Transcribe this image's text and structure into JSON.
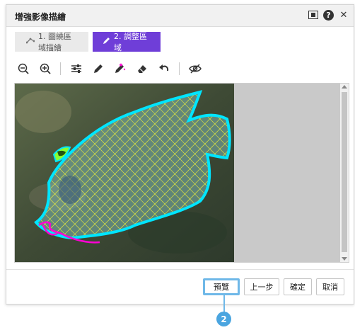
{
  "dialog": {
    "title": "增強影像描繪",
    "steps": [
      {
        "label": "1. 圖繞區域描繪",
        "icon": "polygon-icon"
      },
      {
        "label": "2. 調整區域",
        "icon": "pencil-icon"
      }
    ],
    "toolbar": [
      "zoom-out-icon",
      "zoom-in-icon",
      "adjust-icon",
      "pen-icon",
      "magic-pen-icon",
      "eraser-icon",
      "undo-icon",
      "visibility-icon"
    ],
    "buttons": {
      "preview": "預覽",
      "previous": "上一步",
      "confirm": "確定",
      "cancel": "取消"
    },
    "callout_number": "2"
  },
  "colors": {
    "accent": "#6f3ed8",
    "callout": "#4aa5e0",
    "outline": "#00e5ff",
    "mesh": "#ffff33",
    "stroke": "#ff00d4"
  }
}
